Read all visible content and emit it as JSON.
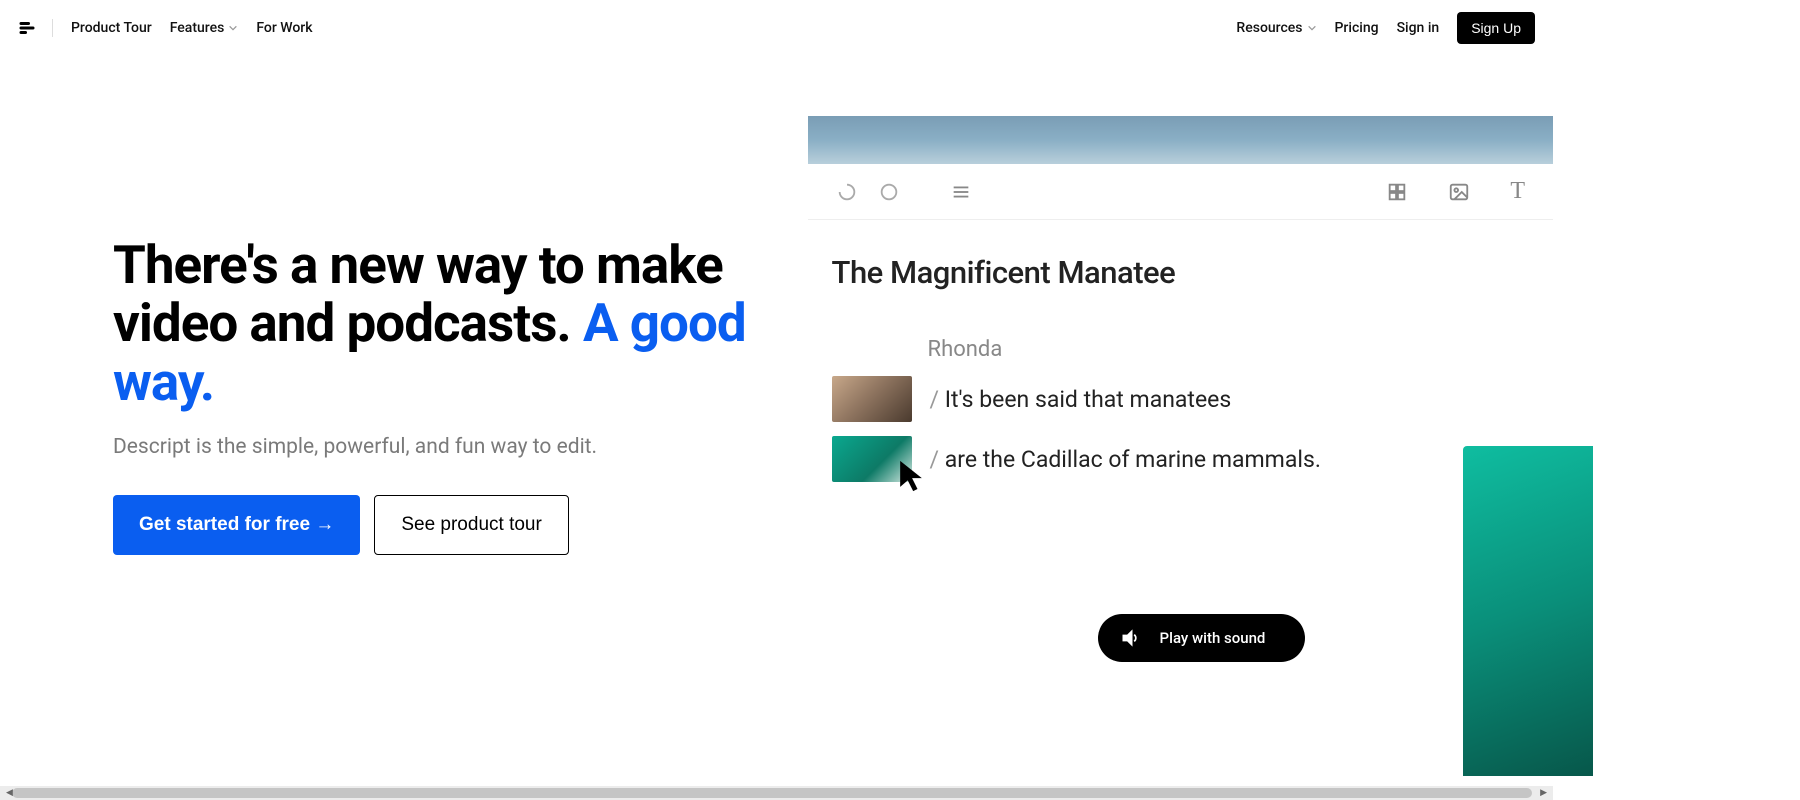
{
  "nav": {
    "product_tour": "Product Tour",
    "features": "Features",
    "for_work": "For Work",
    "resources": "Resources",
    "pricing": "Pricing",
    "sign_in": "Sign in",
    "sign_up": "Sign Up"
  },
  "hero": {
    "headline_part1": "There's a new way to make video and podcasts. ",
    "headline_accent": "A good way.",
    "subhead": "Descript is the simple, powerful, and fun way to edit.",
    "cta_primary": "Get started for free →",
    "cta_secondary": "See product tour"
  },
  "preview": {
    "doc_title": "The Magnificent Manatee",
    "speaker": "Rhonda",
    "line1": "It's been said that manatees",
    "line2": "are the Cadillac of marine mammals.",
    "play_sound": "Play with sound"
  }
}
